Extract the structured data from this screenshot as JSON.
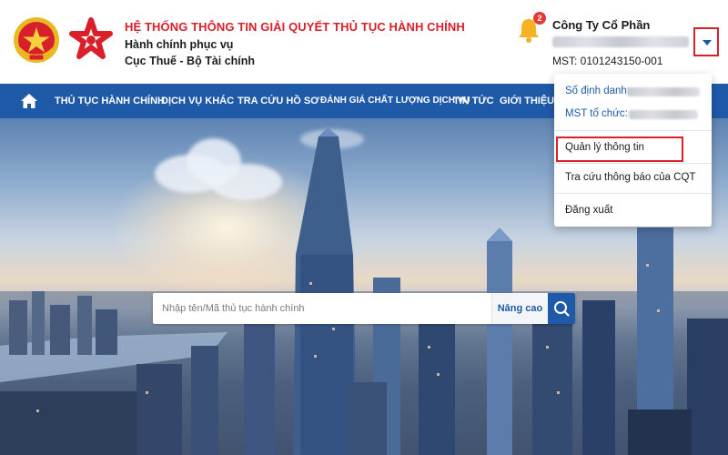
{
  "header": {
    "title": "HỆ THỐNG THÔNG TIN GIẢI QUYẾT THỦ TỤC HÀNH CHÍNH",
    "subtitle1": "Hành chính phục vụ",
    "subtitle2": "Cục Thuế - Bộ Tài chính"
  },
  "notifications": {
    "count": "2"
  },
  "account": {
    "company_name": "Công Ty Cổ Phần",
    "mst_line": "MST: 0101243150-001"
  },
  "nav": {
    "items": [
      "THỦ TỤC HÀNH CHÍNH",
      "DỊCH VỤ KHÁC",
      "TRA CỨU HỒ SƠ",
      "ĐÁNH GIÁ CHẤT LƯỢNG DỊCH VỤ",
      "TIN TỨC",
      "GIỚI THIỆU"
    ]
  },
  "search": {
    "placeholder": "Nhập tên/Mã thủ tục hành chính",
    "advanced_label": "Nâng cao"
  },
  "menu": {
    "id_label": "Số định danh:",
    "org_mst_label": "MST tổ chức:",
    "items": [
      "Quản lý thông tin",
      "Tra cứu thông báo của CQT",
      "Đăng xuất"
    ]
  },
  "colors": {
    "brand_blue": "#1e5aa8",
    "accent_red": "#d9202a",
    "bell_yellow": "#f5b324"
  }
}
